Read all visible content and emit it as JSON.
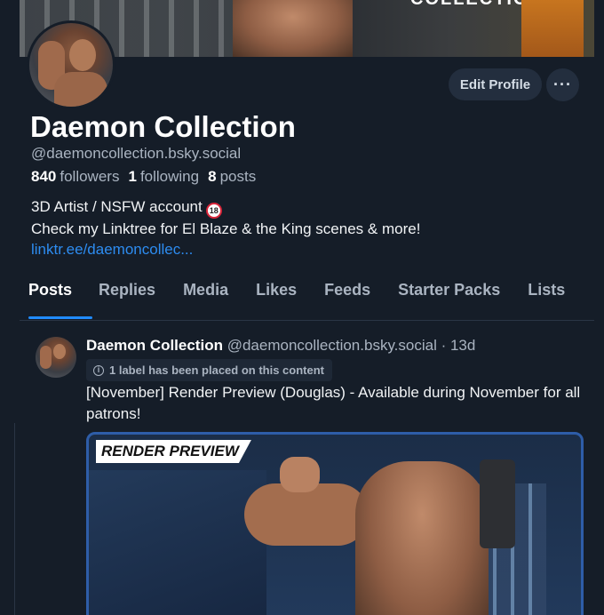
{
  "banner": {
    "title_fragment": "COLLECTION"
  },
  "profile": {
    "name": "Daemon Collection",
    "handle": "@daemoncollection.bsky.social",
    "stats": {
      "followers_count": "840",
      "followers_label": "followers",
      "following_count": "1",
      "following_label": "following",
      "posts_count": "8",
      "posts_label": "posts"
    },
    "bio_line1": "3D Artist / NSFW account",
    "bio_badge": "18",
    "bio_line2": "Check my Linktree for El Blaze & the King scenes & more!",
    "bio_link": "linktr.ee/daemoncollec..."
  },
  "actions": {
    "edit_label": "Edit Profile",
    "more_label": "···"
  },
  "tabs": [
    {
      "label": "Posts",
      "active": true
    },
    {
      "label": "Replies"
    },
    {
      "label": "Media"
    },
    {
      "label": "Likes"
    },
    {
      "label": "Feeds"
    },
    {
      "label": "Starter Packs"
    },
    {
      "label": "Lists"
    }
  ],
  "post": {
    "author_name": "Daemon Collection",
    "author_handle": "@daemoncollection.bsky.social · 13d",
    "label_notice": "1 label has been placed on this content",
    "text": "[November] Render Preview (Douglas) - Available during November for all patrons!",
    "image_label": "RENDER PREVIEW"
  },
  "colors": {
    "background": "#151d28",
    "accent": "#208bfe",
    "link": "#2d8cf0"
  },
  "icons": [
    "more-icon",
    "info-icon",
    "nsfw-18-icon"
  ]
}
